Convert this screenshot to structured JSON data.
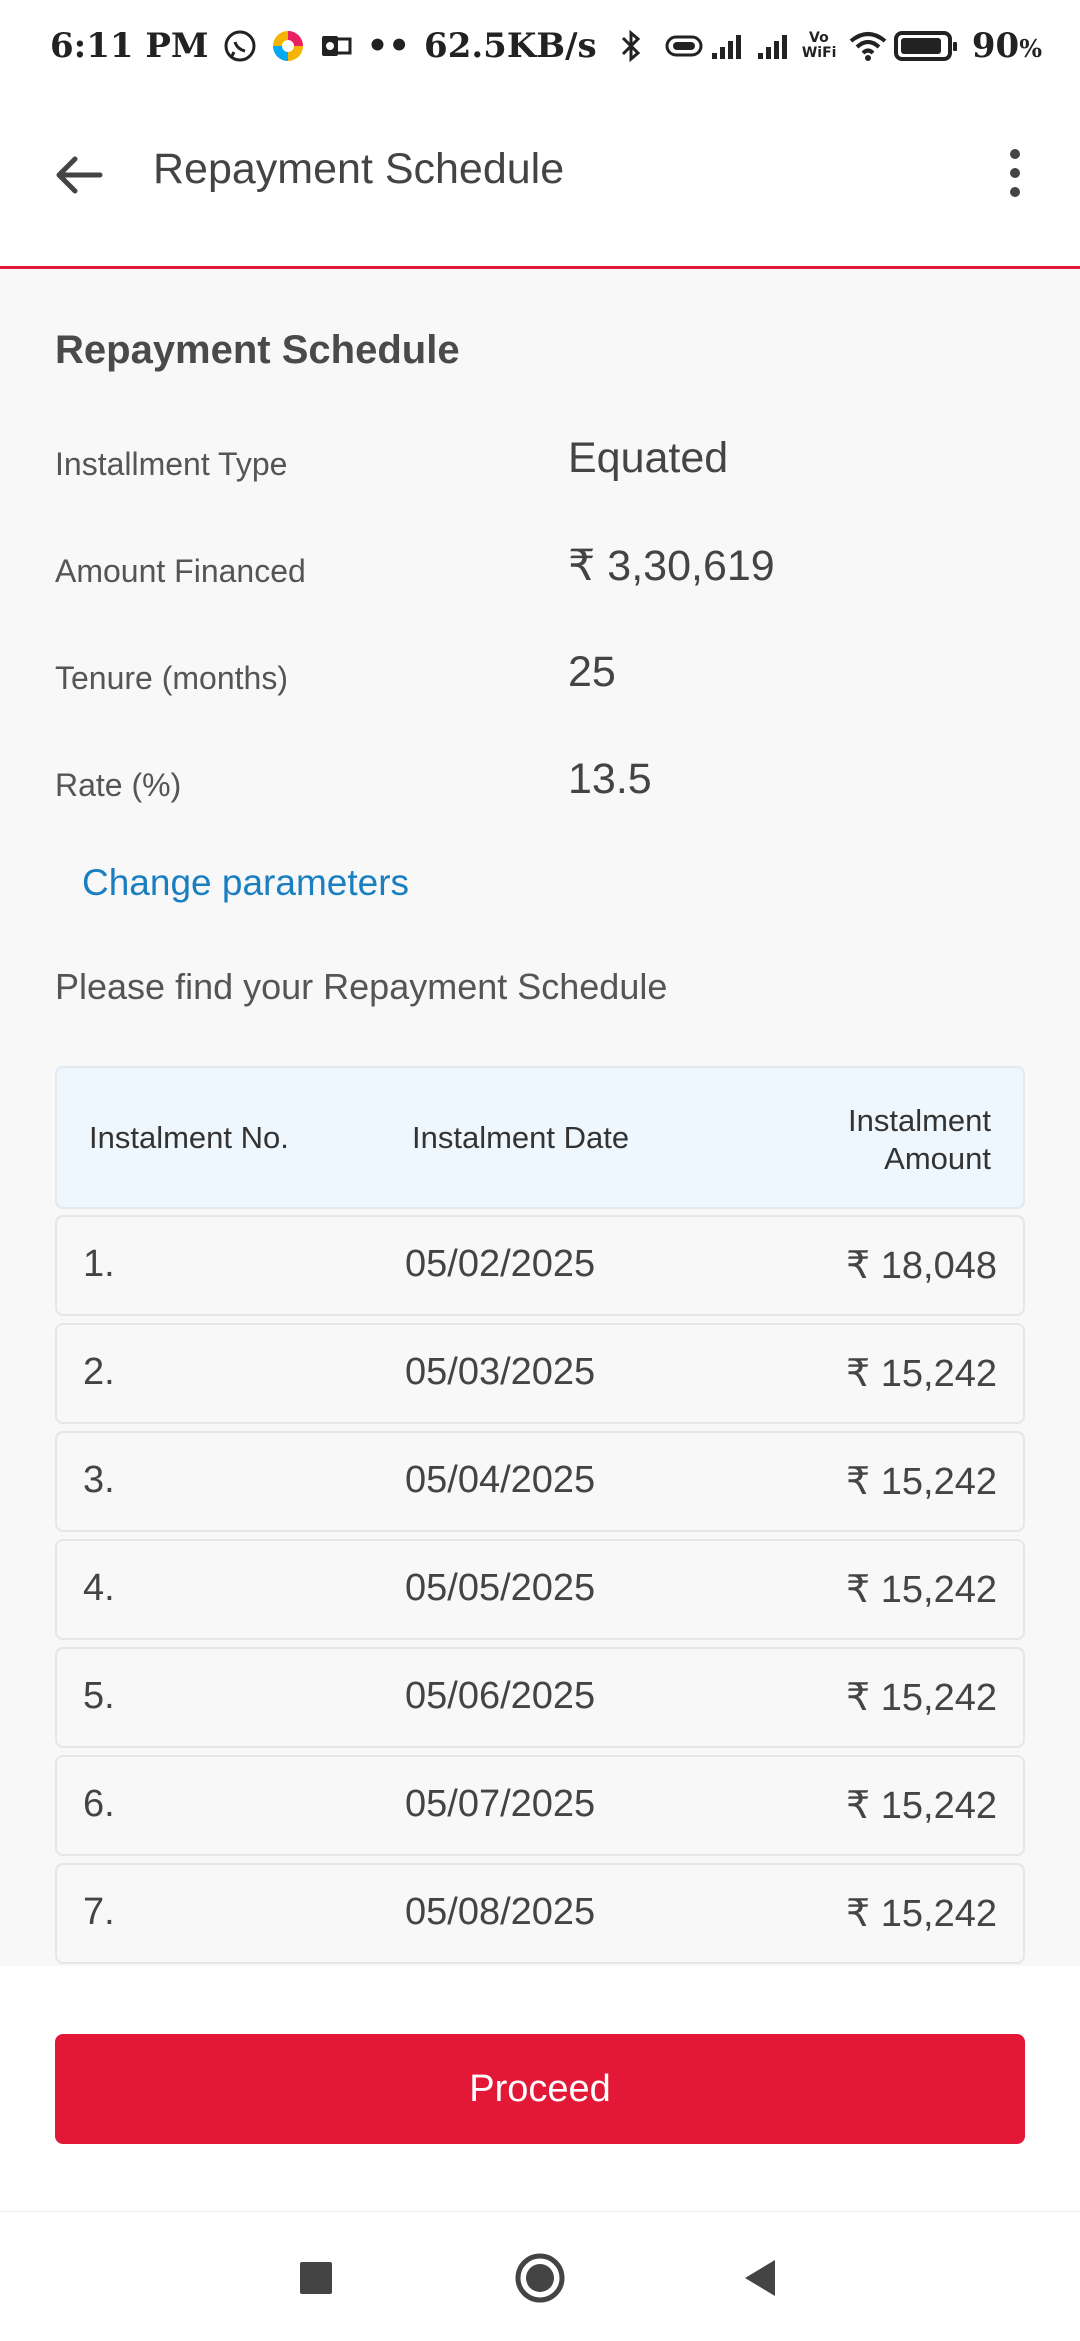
{
  "status_bar": {
    "time": "6:11 PM",
    "dots": "••",
    "network_speed": "62.5KB/s",
    "battery": "90",
    "battery_unit": "%",
    "vowifi": "Vo WiFi"
  },
  "app_bar": {
    "title": "Repayment Schedule"
  },
  "summary": {
    "title": "Repayment Schedule",
    "rows": [
      {
        "label": "Installment Type",
        "value": "Equated"
      },
      {
        "label": "Amount Financed",
        "value": "₹ 3,30,619"
      },
      {
        "label": "Tenure (months)",
        "value": "25"
      },
      {
        "label": "Rate (%)",
        "value": "13.5"
      }
    ],
    "change_link": "Change parameters",
    "intro": "Please find your Repayment Schedule"
  },
  "table": {
    "headers": {
      "no": "Instalment No.",
      "date": "Instalment Date",
      "amount_line1": "Instalment",
      "amount_line2": "Amount"
    },
    "rows": [
      {
        "no": "1.",
        "date": "05/02/2025",
        "amount": "₹ 18,048"
      },
      {
        "no": "2.",
        "date": "05/03/2025",
        "amount": "₹ 15,242"
      },
      {
        "no": "3.",
        "date": "05/04/2025",
        "amount": "₹ 15,242"
      },
      {
        "no": "4.",
        "date": "05/05/2025",
        "amount": "₹ 15,242"
      },
      {
        "no": "5.",
        "date": "05/06/2025",
        "amount": "₹ 15,242"
      },
      {
        "no": "6.",
        "date": "05/07/2025",
        "amount": "₹ 15,242"
      },
      {
        "no": "7.",
        "date": "05/08/2025",
        "amount": "₹ 15,242"
      },
      {
        "no": "",
        "date": "",
        "amount": ""
      }
    ]
  },
  "footer": {
    "proceed_label": "Proceed"
  },
  "colors": {
    "accent": "#e31837",
    "link": "#1a7fc1",
    "header_bg": "#eef7fd"
  },
  "icons": {
    "back": "arrow-left-icon",
    "more": "more-vertical-icon",
    "nav_recents": "square-icon",
    "nav_home": "circle-icon",
    "nav_back": "triangle-left-icon"
  }
}
